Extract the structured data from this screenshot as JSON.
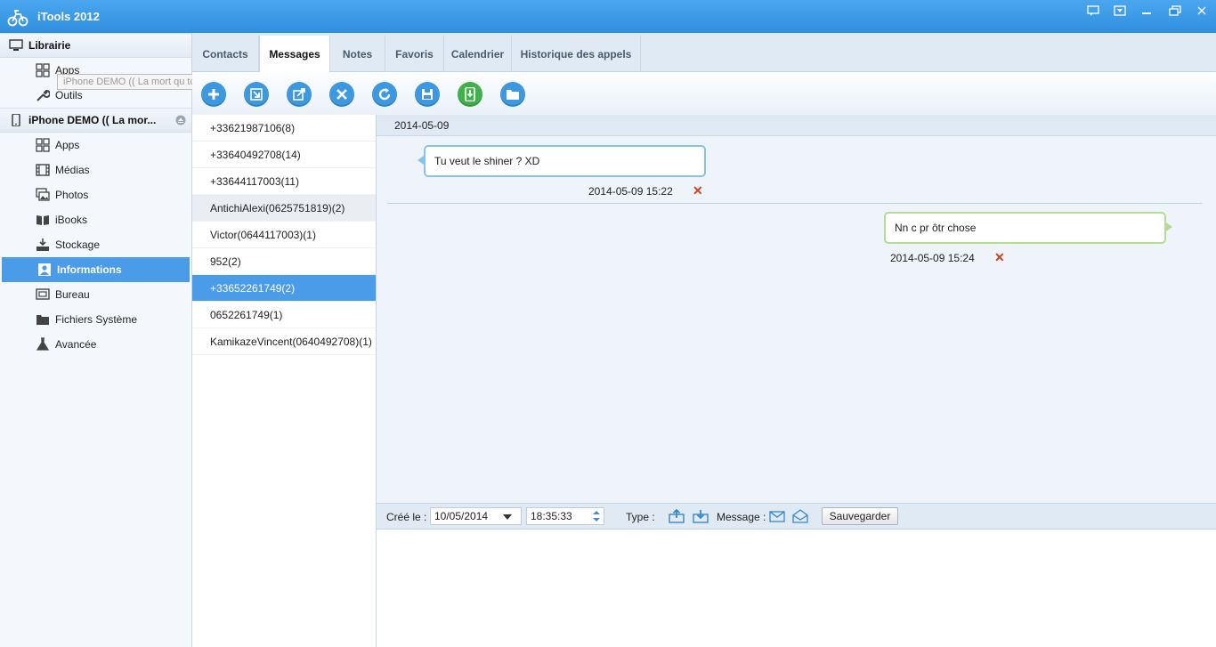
{
  "app": {
    "title": "iTools 2012"
  },
  "sidebar": {
    "library": {
      "label": "Librairie",
      "items": [
        {
          "label": "Apps",
          "icon": "grid-icon"
        },
        {
          "label": "Outils",
          "icon": "wrench-icon"
        }
      ]
    },
    "device": {
      "label": "iPhone DEMO (( La mor...",
      "tooltip": "iPhone DEMO (( La mort qu tchétché ) ??)",
      "items": [
        {
          "label": "Apps",
          "icon": "grid-icon"
        },
        {
          "label": "Médias",
          "icon": "film-icon"
        },
        {
          "label": "Photos",
          "icon": "photo-icon"
        },
        {
          "label": "iBooks",
          "icon": "book-icon"
        },
        {
          "label": "Stockage",
          "icon": "storage-icon"
        },
        {
          "label": "Informations",
          "icon": "contact-card-icon",
          "active": true
        },
        {
          "label": "Bureau",
          "icon": "desktop-icon"
        },
        {
          "label": "Fichiers Système",
          "icon": "folder-icon"
        },
        {
          "label": "Avancée",
          "icon": "flask-icon"
        }
      ]
    }
  },
  "tabs": [
    {
      "label": "Contacts"
    },
    {
      "label": "Messages",
      "active": true
    },
    {
      "label": "Notes"
    },
    {
      "label": "Favoris"
    },
    {
      "label": "Calendrier"
    },
    {
      "label": "Historique des appels"
    }
  ],
  "toolbar": {
    "buttons": [
      "add-icon",
      "import-icon",
      "edit-icon",
      "delete-icon",
      "refresh-icon",
      "save-icon",
      "phone-download-icon",
      "folder-icon"
    ]
  },
  "threads": [
    "+33621987106(8)",
    "+33640492708(14)",
    "+33644117003(11)",
    "AntichiAlexi(0625751819)(2)",
    "Victor(0644117003)(1)",
    "952(2)",
    "+33652261749(2)",
    "0652261749(1)",
    "KamikazeVincent(0640492708)(1)"
  ],
  "selected_thread": "+33652261749(2)",
  "conversation": {
    "date": "2014-05-09",
    "messages": [
      {
        "direction": "in",
        "text": "Tu veut le shiner ? XD",
        "time": "2014-05-09 15:22"
      },
      {
        "direction": "out",
        "text": "Nn c pr ôtr chose",
        "time": "2014-05-09 15:24"
      }
    ]
  },
  "editor": {
    "created_label": "Créé le :",
    "date_value": "10/05/2014",
    "time_value": "18:35:33",
    "type_label": "Type :",
    "message_label": "Message :",
    "save_label": "Sauvegarder"
  },
  "colors": {
    "accent": "#4a9ce8",
    "titlebar": "#3a9ae8",
    "incoming_border": "#86c4ec",
    "outgoing_border": "#b4dc96",
    "delete": "#d2401e"
  }
}
